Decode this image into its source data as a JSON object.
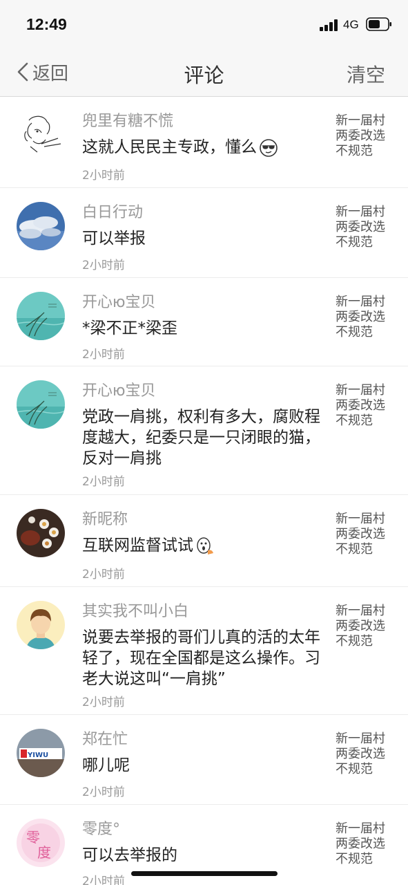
{
  "status_bar": {
    "time": "12:49",
    "network": "4G"
  },
  "header": {
    "back_label": "返回",
    "title": "评论",
    "clear_label": "清空"
  },
  "comments": [
    {
      "name": "兜里有糖不慌",
      "text": "这就人民民主专政，懂么",
      "time": "2小时前",
      "tag": "新一届村两委改选不规范",
      "avatar": "sketch-portrait"
    },
    {
      "name": "白日行动",
      "text": "可以举报",
      "time": "2小时前",
      "tag": "新一届村两委改选不规范",
      "avatar": "sky-clouds"
    },
    {
      "name": "开心ю宝贝",
      "text": "*梁不正*梁歪",
      "time": "2小时前",
      "tag": "新一届村两委改选不规范",
      "avatar": "lake-reeds"
    },
    {
      "name": "开心ю宝贝",
      "text": "党政一肩挑，权利有多大，腐败程度越大，纪委只是一只闭眼的猫，反对一肩挑",
      "time": "2小时前",
      "tag": "新一届村两委改选不规范",
      "avatar": "lake-reeds"
    },
    {
      "name": "新昵称",
      "text": "互联网监督试试",
      "time": "2小时前",
      "tag": "新一届村两委改选不规范",
      "avatar": "tea-set"
    },
    {
      "name": "其实我不叫小白",
      "text": "说要去举报的哥们儿真的活的太年轻了，现在全国都是这么操作。习老大说这叫“一肩挑”",
      "time": "2小时前",
      "tag": "新一届村两委改选不规范",
      "avatar": "cartoon-person"
    },
    {
      "name": "郑在忙",
      "text": "哪儿呢",
      "time": "2小时前",
      "tag": "新一届村两委改选不规范",
      "avatar": "yiwu-sign"
    },
    {
      "name": "零度°",
      "text": "可以去举报的",
      "time": "2小时前",
      "tag": "新一届村两委改选不规范",
      "avatar": "pink-text-logo",
      "avatar_text": [
        "零",
        "度"
      ]
    }
  ],
  "colors": {
    "nav_bg": "#f7f7f7",
    "divider": "#ececec",
    "meta_text": "#999999"
  }
}
